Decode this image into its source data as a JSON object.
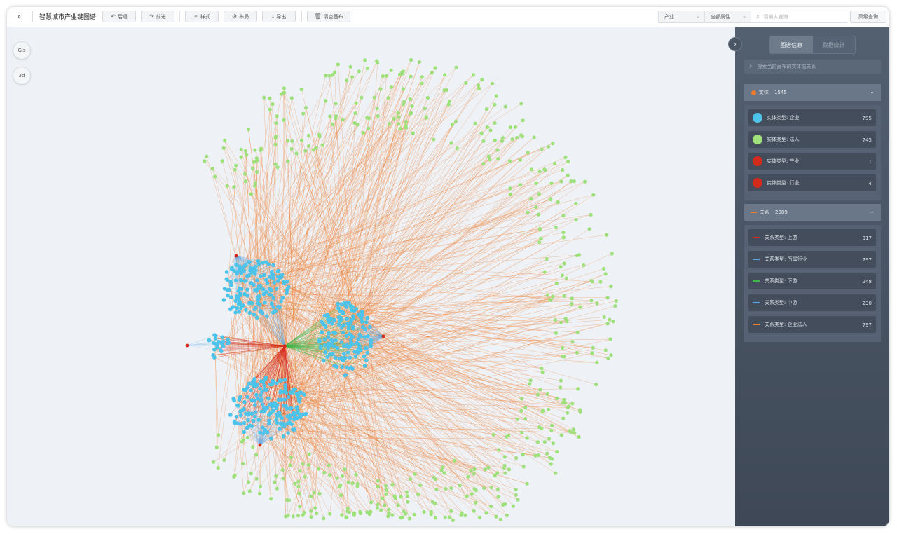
{
  "topbar": {
    "back_icon": "chevron-left-icon",
    "title": "智慧城市产业链图谱",
    "buttons": [
      {
        "label": "后退",
        "icon": "undo-icon"
      },
      {
        "label": "前进",
        "icon": "redo-icon"
      },
      {
        "label": "样式",
        "icon": "magic-wand-icon"
      },
      {
        "label": "布局",
        "icon": "gear-icon"
      },
      {
        "label": "导出",
        "icon": "download-icon"
      },
      {
        "label": "清空画布",
        "icon": "trash-icon"
      }
    ],
    "type_select": "产业",
    "attr_select": "全部属性",
    "search_placeholder": "请输入查询",
    "advanced_query": "高级查询"
  },
  "canvas": {
    "gis_label": "Gis",
    "three_d_label": "3d"
  },
  "panel": {
    "tabs": [
      {
        "label": "图谱信息",
        "active": true
      },
      {
        "label": "数据统计",
        "active": false
      }
    ],
    "search_placeholder": "搜索当前画布的实体或关系",
    "entities": {
      "title": "实体",
      "count": "1545",
      "color": "#f07b2a",
      "items": [
        {
          "label": "实体类型: 企业",
          "value": "795",
          "color": "#4cc3ea"
        },
        {
          "label": "实体类型: 法人",
          "value": "745",
          "color": "#9ee07a"
        },
        {
          "label": "实体类型: 产业",
          "value": "1",
          "color": "#d42a1c"
        },
        {
          "label": "实体类型: 行业",
          "value": "4",
          "color": "#d42a1c"
        }
      ]
    },
    "relations": {
      "title": "关系",
      "count": "2389",
      "color": "#f07b2a",
      "items": [
        {
          "label": "关系类型: 上游",
          "value": "317",
          "color": "#d42a1c"
        },
        {
          "label": "关系类型: 所属行业",
          "value": "797",
          "color": "#5aa9e6"
        },
        {
          "label": "关系类型: 下游",
          "value": "248",
          "color": "#3fb84a"
        },
        {
          "label": "关系类型: 中游",
          "value": "230",
          "color": "#5aa9e6"
        },
        {
          "label": "关系类型: 企业法人",
          "value": "797",
          "color": "#f07b2a"
        }
      ]
    }
  },
  "graph_colors": {
    "enterprise": "#4cc3ea",
    "person": "#9ee07a",
    "industry": "#d42a1c",
    "edge_legal": "#f07b2a",
    "edge_upstream": "#d42a1c",
    "edge_downstream": "#3fb84a",
    "edge_belongs": "#5aa9e6"
  }
}
